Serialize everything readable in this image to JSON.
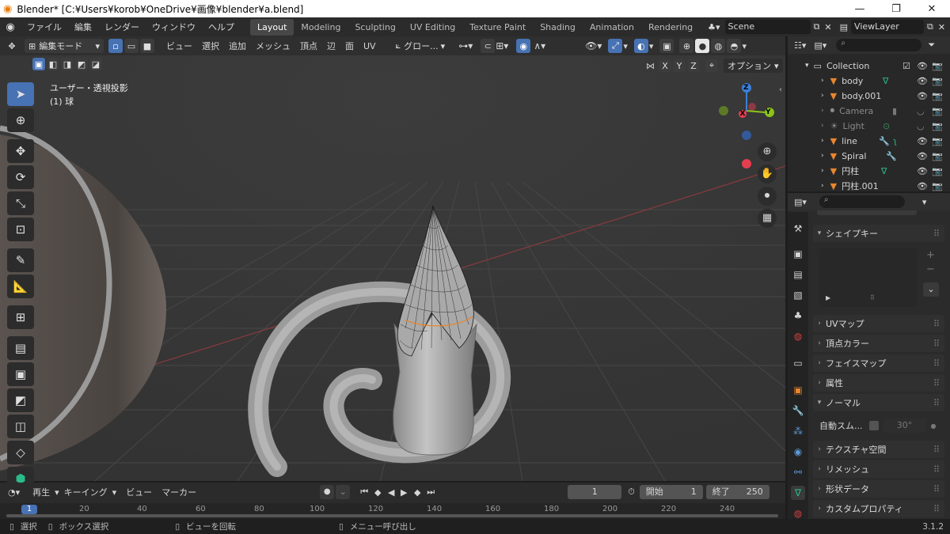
{
  "window": {
    "title": "Blender* [C:¥Users¥korob¥OneDrive¥画像¥blender¥a.blend]",
    "minimize": "—",
    "maximize": "❐",
    "close": "✕"
  },
  "menus": [
    "ファイル",
    "編集",
    "レンダー",
    "ウィンドウ",
    "ヘルプ"
  ],
  "workspaces": [
    "Layout",
    "Modeling",
    "Sculpting",
    "UV Editing",
    "Texture Paint",
    "Shading",
    "Animation",
    "Rendering"
  ],
  "active_workspace": "Layout",
  "scene": "Scene",
  "view_layer": "ViewLayer",
  "viewport_header": {
    "mode": "編集モード",
    "menus": [
      "ビュー",
      "選択",
      "追加",
      "メッシュ",
      "頂点",
      "辺",
      "面",
      "UV"
    ],
    "transform_orientation": "グロー...",
    "axes": [
      "X",
      "Y",
      "Z"
    ],
    "options": "オプション"
  },
  "viewport": {
    "view_name": "ユーザー・透視投影",
    "object_info": "(1) 球"
  },
  "gizmo": {
    "x": "X",
    "y": "Y",
    "z": "Z"
  },
  "outliner": {
    "collection": "Collection",
    "items": [
      {
        "name": "body",
        "dim": false
      },
      {
        "name": "body.001",
        "dim": false
      },
      {
        "name": "Camera",
        "dim": true
      },
      {
        "name": "Light",
        "dim": true
      },
      {
        "name": "line",
        "dim": false
      },
      {
        "name": "Spiral",
        "dim": false
      },
      {
        "name": "円柱",
        "dim": false
      },
      {
        "name": "円柱.001",
        "dim": false
      }
    ]
  },
  "properties": {
    "shape_keys": "シェイプキー",
    "panels": [
      "UVマップ",
      "頂点カラー",
      "フェイスマップ",
      "属性"
    ],
    "normals": "ノーマル",
    "auto_smooth_label": "自動スム...",
    "auto_smooth_angle": "30°",
    "panels2": [
      "テクスチャ空間",
      "リメッシュ",
      "形状データ",
      "カスタムプロパティ"
    ]
  },
  "timeline": {
    "menus": [
      "再生",
      "キーイング",
      "ビュー",
      "マーカー"
    ],
    "current_frame": "1",
    "start_label": "開始",
    "start": "1",
    "end_label": "終了",
    "end": "250",
    "ticks": [
      "1",
      "20",
      "40",
      "60",
      "80",
      "100",
      "120",
      "140",
      "160",
      "180",
      "200",
      "220",
      "240"
    ]
  },
  "status": {
    "select": "選択",
    "box_select": "ボックス選択",
    "rotate": "ビューを回転",
    "menu": "メニュー呼び出し",
    "version": "3.1.2"
  },
  "colors": {
    "accent": "#4772b3",
    "object_orange": "#e8862e",
    "mesh_green": "#2bba8c",
    "modifier_blue": "#5d97d6",
    "axis_x": "#e63e4f",
    "axis_y": "#8bc418",
    "axis_z": "#3c7fd8"
  }
}
